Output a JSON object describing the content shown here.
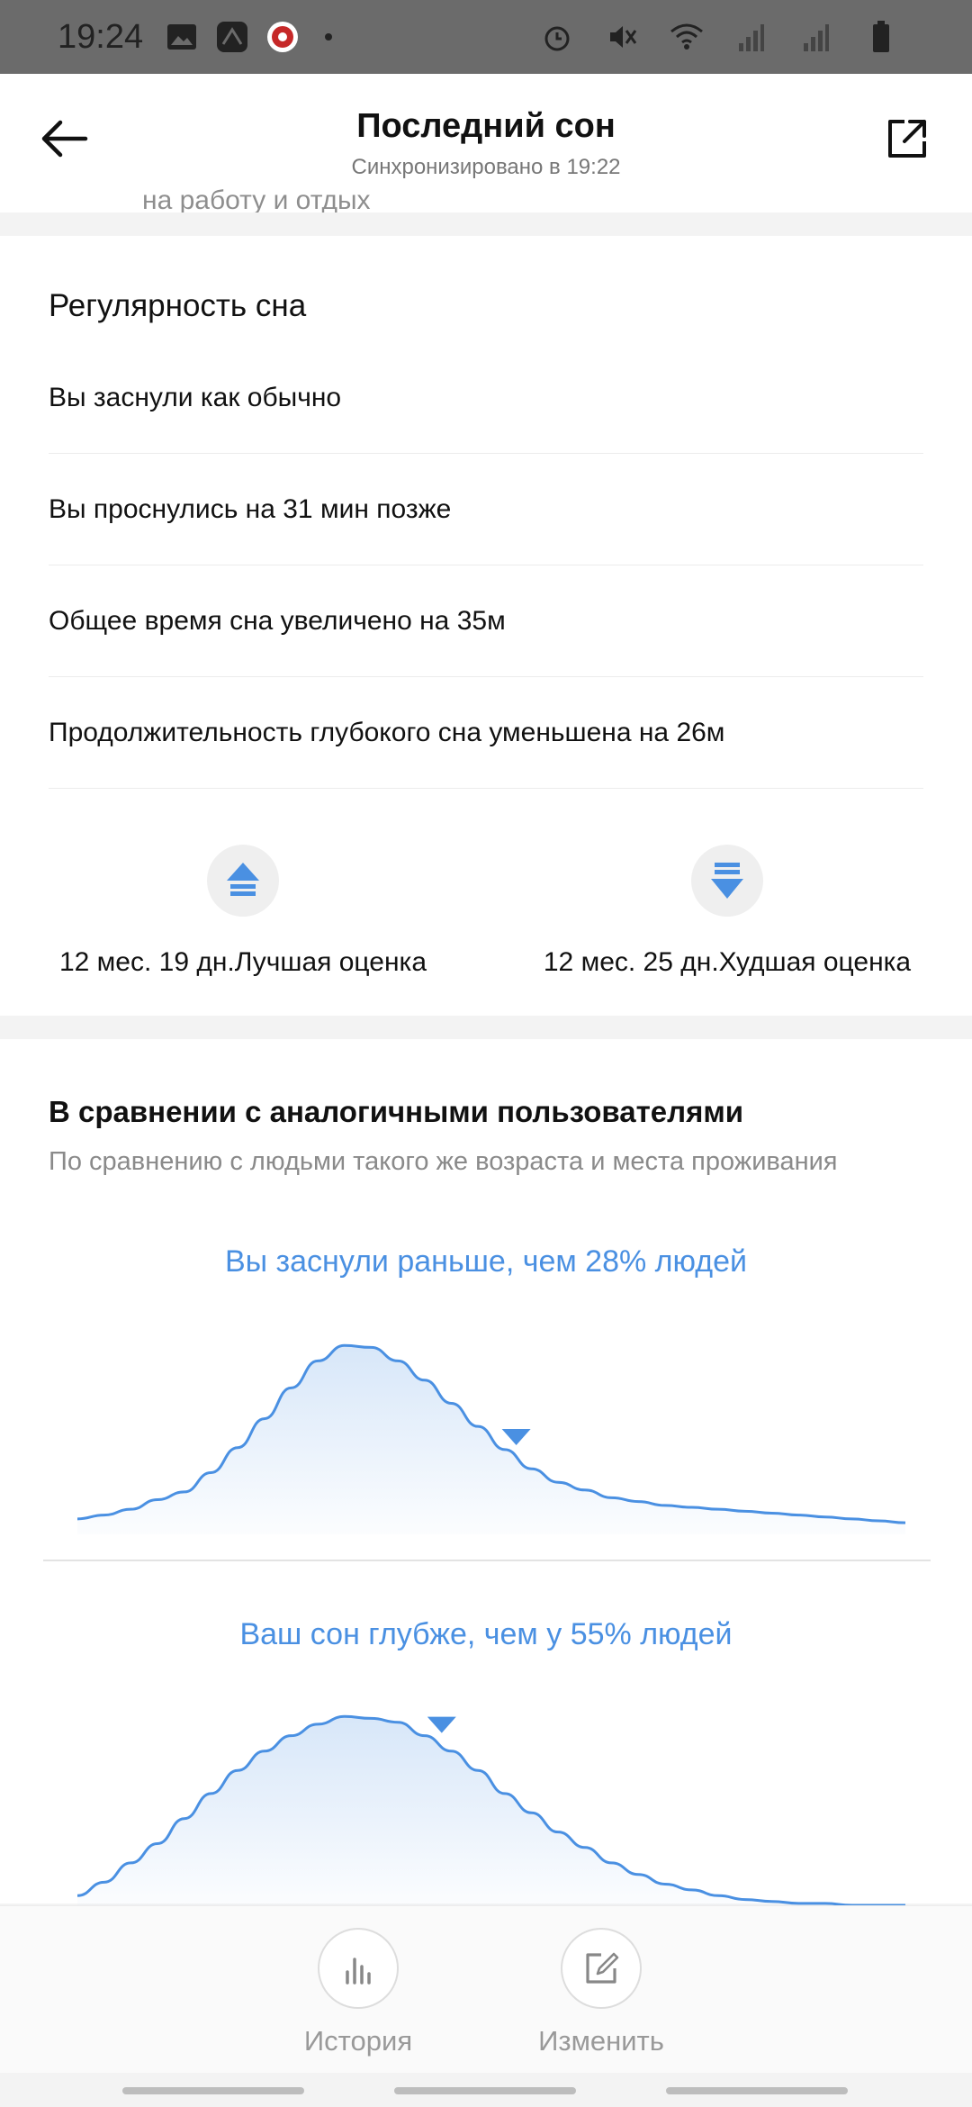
{
  "status": {
    "time": "19:24"
  },
  "header": {
    "title": "Последний сон",
    "subtitle": "Синхронизировано в 19:22",
    "cut_text": "на работу и отдых"
  },
  "regularity": {
    "title": "Регулярность сна",
    "items": [
      "Вы заснули как обычно",
      "Вы проснулись на 31 мин позже",
      "Общее время сна увеличено на 35м",
      "Продолжительность глубокого сна уменьшена на 26м"
    ],
    "best_label": "12 мес. 19 дн.Лучшая оценка",
    "worst_label": "12 мес. 25 дн.Худшая оценка"
  },
  "compare": {
    "title": "В сравнении с аналогичными пользователями",
    "subtitle": "По сравнению с людьми такого же возраста и места проживания",
    "charts": [
      {
        "caption": "Вы заснули раньше, чем 28% людей",
        "marker_fraction": 0.53,
        "curve": [
          0.08,
          0.1,
          0.13,
          0.18,
          0.22,
          0.32,
          0.45,
          0.6,
          0.76,
          0.9,
          0.98,
          0.97,
          0.9,
          0.8,
          0.68,
          0.56,
          0.44,
          0.34,
          0.27,
          0.23,
          0.19,
          0.17,
          0.15,
          0.14,
          0.13,
          0.12,
          0.11,
          0.1,
          0.09,
          0.08,
          0.07,
          0.06
        ]
      },
      {
        "caption": "Ваш сон глубже, чем у 55% людей",
        "marker_fraction": 0.44,
        "curve": [
          0.05,
          0.12,
          0.22,
          0.32,
          0.45,
          0.58,
          0.7,
          0.8,
          0.88,
          0.94,
          0.98,
          0.97,
          0.95,
          0.88,
          0.8,
          0.7,
          0.58,
          0.48,
          0.38,
          0.3,
          0.22,
          0.16,
          0.11,
          0.08,
          0.05,
          0.03,
          0.02,
          0.01,
          0.01,
          0.0,
          0.0,
          0.0
        ]
      }
    ]
  },
  "actions": {
    "history_label": "История",
    "edit_label": "Изменить"
  },
  "colors": {
    "accent": "#4a90e2"
  }
}
